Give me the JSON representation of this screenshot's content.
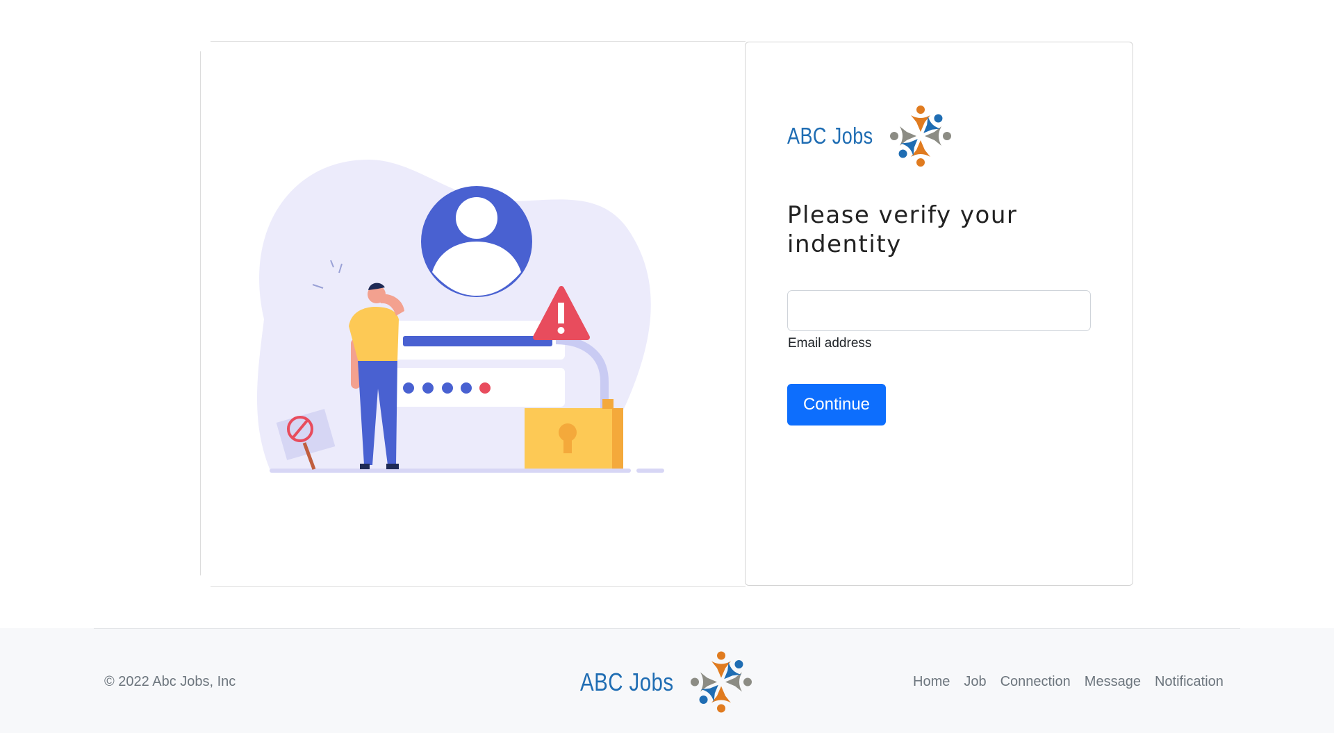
{
  "brand": {
    "name": "ABC Jobs"
  },
  "verify": {
    "heading": "Please verify your indentity",
    "email_value": "",
    "email_label": "Email address",
    "continue_label": "Continue"
  },
  "footer": {
    "copyright": "© 2022 Abc Jobs, Inc",
    "brand_name": "ABC Jobs",
    "nav": [
      "Home",
      "Job",
      "Connection",
      "Message",
      "Notification"
    ]
  },
  "colors": {
    "brand_blue": "#1f6db3",
    "brand_orange": "#e07b1f",
    "brand_gray": "#8c8c84",
    "primary_button": "#0d6efd",
    "footer_bg": "#f7f8fa"
  }
}
